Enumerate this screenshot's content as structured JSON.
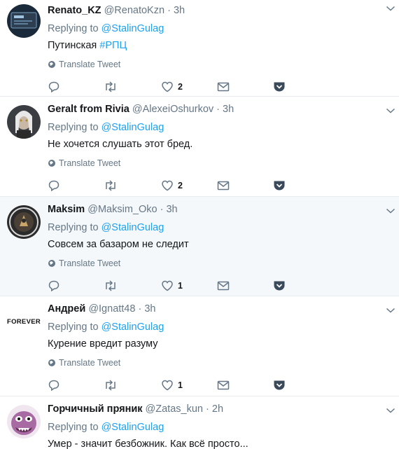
{
  "translate_label": "Translate Tweet",
  "tweets": [
    {
      "name": "Renato_KZ",
      "handle": "@RenatoKzn",
      "time": "3h",
      "reply_prefix": "Replying to",
      "reply_user": "@StalinGulag",
      "text": "Путинская ",
      "hashtag": "#РПЦ",
      "likes": "2",
      "avatar_icon": "chip-avatar"
    },
    {
      "name": "Geralt from Rivia",
      "handle": "@AlexeiOshurkov",
      "time": "3h",
      "reply_prefix": "Replying to",
      "reply_user": "@StalinGulag",
      "text": "Не хочется слушать этот бред.",
      "likes": "2",
      "avatar_icon": "witcher-avatar"
    },
    {
      "name": "Maksim",
      "handle": "@Maksim_Oko",
      "time": "3h",
      "reply_prefix": "Replying to",
      "reply_user": "@StalinGulag",
      "text": "Совсем за базаром не следит",
      "likes": "1",
      "avatar_icon": "emblem-avatar"
    },
    {
      "name": "Андрей",
      "handle": "@Ignatt48",
      "time": "3h",
      "reply_prefix": "Replying to",
      "reply_user": "@StalinGulag",
      "text": "Курение вредит разуму",
      "likes": "1",
      "avatar_text": "FOREVER"
    },
    {
      "name": "Горчичный пряник",
      "handle": "@Zatas_kun",
      "time": "2h",
      "reply_prefix": "Replying to",
      "reply_user": "@StalinGulag",
      "text": "Умер - значит безбожник. Как всё просто...",
      "avatar_icon": "monster-avatar"
    }
  ],
  "colors": {
    "link": "#1da1f2",
    "muted": "#657786",
    "highlight_bg": "#f5f8fa",
    "dm_icon": "#657786"
  }
}
